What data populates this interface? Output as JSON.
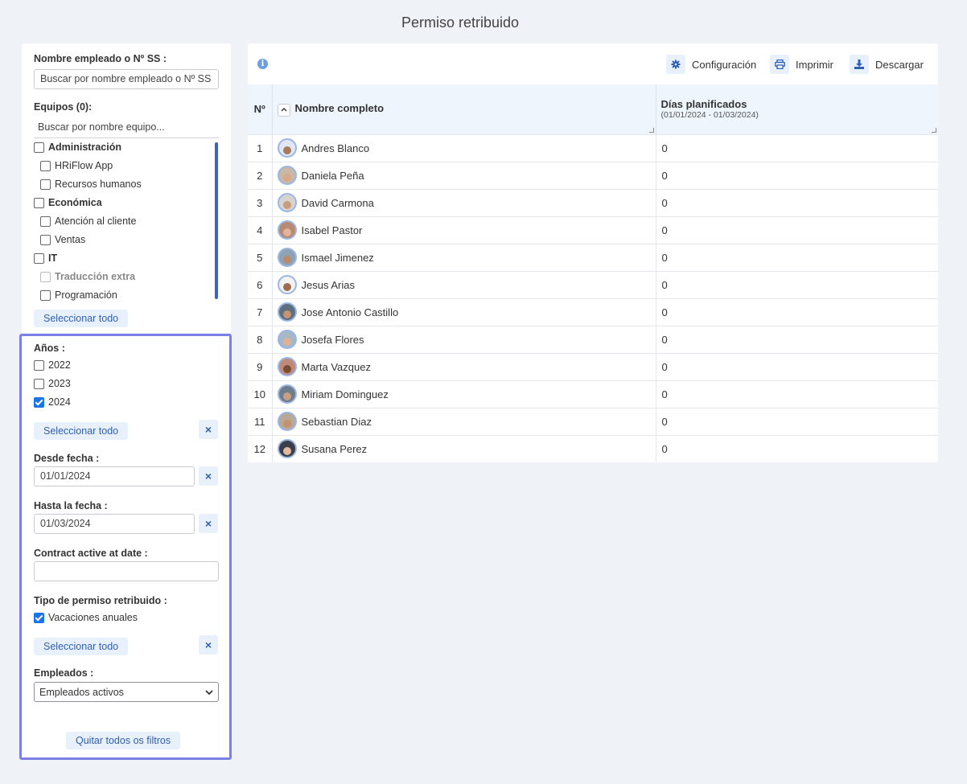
{
  "page": {
    "title": "Permiso retribuido"
  },
  "filters": {
    "employee_label": "Nombre empleado o Nº SS :",
    "employee_placeholder": "Buscar por nombre empleado o Nº SS",
    "teams_label": "Equipos (0):",
    "teams_placeholder": "Buscar por nombre equipo...",
    "teams": [
      {
        "label": "Administración",
        "type": "group",
        "checked": false
      },
      {
        "label": "HRiFlow App",
        "type": "sub",
        "checked": false
      },
      {
        "label": "Recursos humanos",
        "type": "sub",
        "checked": false
      },
      {
        "label": "Económica",
        "type": "group",
        "checked": false
      },
      {
        "label": "Atención al cliente",
        "type": "sub",
        "checked": false
      },
      {
        "label": "Ventas",
        "type": "sub",
        "checked": false
      },
      {
        "label": "IT",
        "type": "group",
        "checked": false
      },
      {
        "label": "Traducción extra",
        "type": "disabled",
        "checked": false
      },
      {
        "label": "Programación",
        "type": "sub",
        "checked": false
      }
    ],
    "select_all": "Seleccionar todo",
    "years_label": "Años :",
    "years": [
      {
        "label": "2022",
        "checked": false
      },
      {
        "label": "2023",
        "checked": false
      },
      {
        "label": "2024",
        "checked": true
      }
    ],
    "clear_icon": "×",
    "from_label": "Desde fecha :",
    "from_value": "01/01/2024",
    "to_label": "Hasta la fecha :",
    "to_value": "01/03/2024",
    "contract_label": "Contract active at date :",
    "contract_value": "",
    "leave_type_label": "Tipo de permiso retribuido :",
    "leave_types": [
      {
        "label": "Vacaciones anuales",
        "checked": true
      }
    ],
    "employees_label": "Empleados :",
    "employees_value": "Empleados activos",
    "remove_filters": "Quitar todos os filtros"
  },
  "toolbar": {
    "config_label": "Configuración",
    "print_label": "Imprimir",
    "download_label": "Descargar"
  },
  "table": {
    "col_num": "Nº",
    "col_name": "Nombre completo",
    "col_days": "Días planificados",
    "col_days_range": "(01/01/2024 - 01/03/2024)",
    "rows": [
      {
        "n": "1",
        "name": "Andres Blanco",
        "days": "0",
        "skin": "#a67a5b",
        "bg": "#dfe7f2"
      },
      {
        "n": "2",
        "name": "Daniela Peña",
        "days": "0",
        "skin": "#d8a88a",
        "bg": "#c9b8a6"
      },
      {
        "n": "3",
        "name": "David Carmona",
        "days": "0",
        "skin": "#c89c7d",
        "bg": "#d7d4cf"
      },
      {
        "n": "4",
        "name": "Isabel Pastor",
        "days": "0",
        "skin": "#e0b59a",
        "bg": "#b98a72"
      },
      {
        "n": "5",
        "name": "Ismael Jimenez",
        "days": "0",
        "skin": "#b88b6c",
        "bg": "#8fa2b4"
      },
      {
        "n": "6",
        "name": "Jesus Arias",
        "days": "0",
        "skin": "#9c6d4f",
        "bg": "#f2f2f2"
      },
      {
        "n": "7",
        "name": "Jose Antonio Castillo",
        "days": "0",
        "skin": "#c49473",
        "bg": "#5d6f80"
      },
      {
        "n": "8",
        "name": "Josefa Flores",
        "days": "0",
        "skin": "#deb199",
        "bg": "#a6b8c6"
      },
      {
        "n": "9",
        "name": "Marta Vazquez",
        "days": "0",
        "skin": "#7a4c34",
        "bg": "#c08a7a"
      },
      {
        "n": "10",
        "name": "Miriam Dominguez",
        "days": "0",
        "skin": "#c79f86",
        "bg": "#6e7d8a"
      },
      {
        "n": "11",
        "name": "Sebastian Diaz",
        "days": "0",
        "skin": "#c2926f",
        "bg": "#b9a896"
      },
      {
        "n": "12",
        "name": "Susana Perez",
        "days": "0",
        "skin": "#e3b9a0",
        "bg": "#3a3f4a"
      }
    ]
  }
}
